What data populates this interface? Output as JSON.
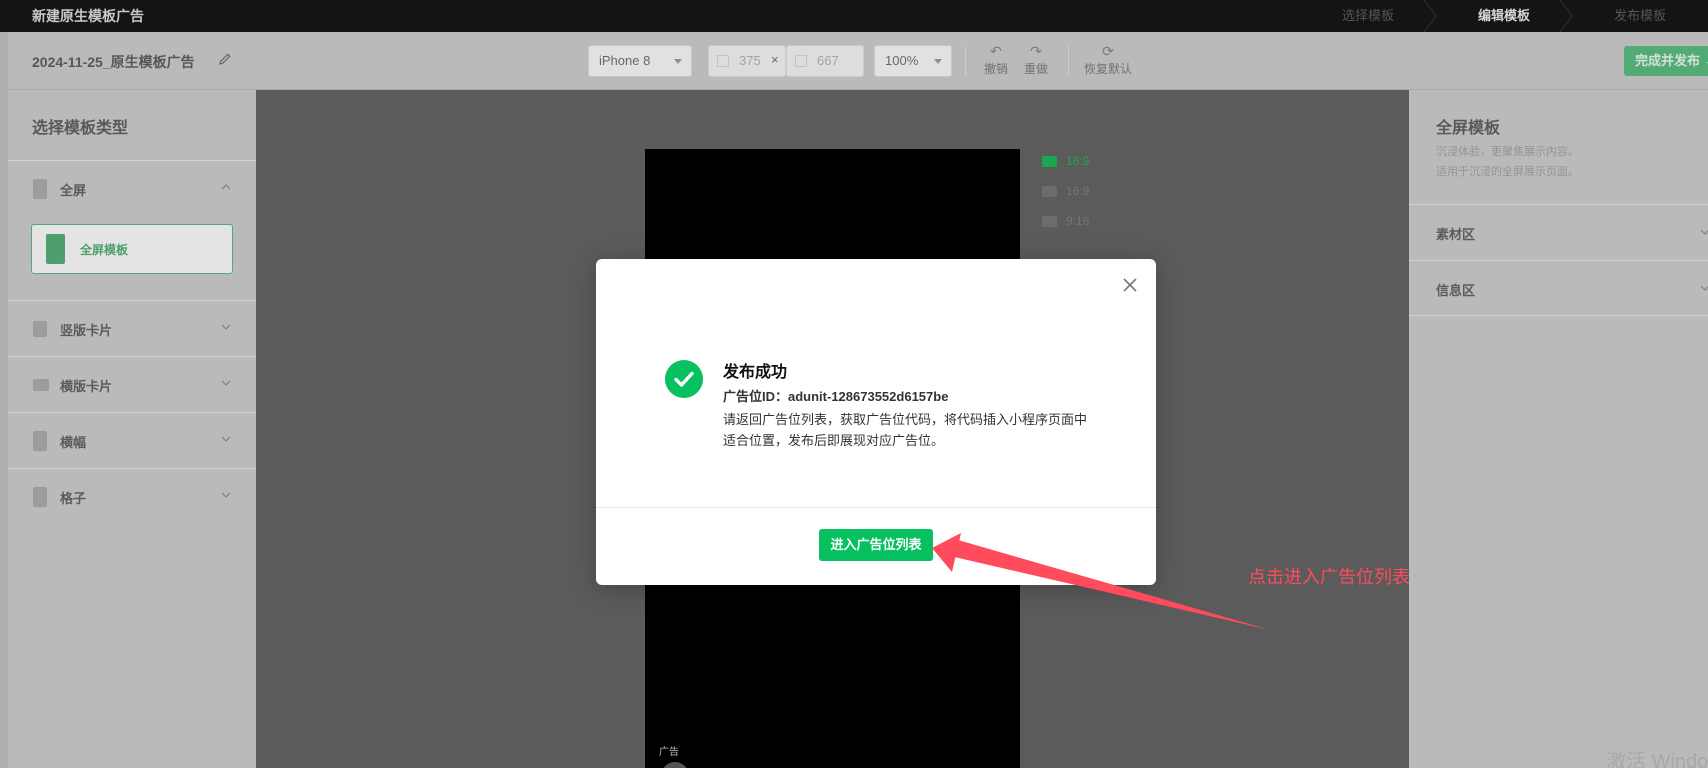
{
  "window": {
    "title": "新建原生模板广告"
  },
  "steps": [
    {
      "label": "选择模板",
      "active": false
    },
    {
      "label": "编辑模板",
      "active": true
    },
    {
      "label": "发布模板",
      "active": false
    }
  ],
  "toolbar": {
    "doc_title": "2024-11-25_原生模板广告",
    "device": "iPhone 8",
    "width": "375",
    "height": "667",
    "times": "×",
    "zoom": "100%",
    "undo_label": "撤销",
    "redo_label": "重做",
    "reset_label": "恢复默认",
    "publish_label": "完成并发布 →"
  },
  "left": {
    "title": "选择模板类型",
    "categories": [
      {
        "label": "全屏",
        "expanded": true
      },
      {
        "label": "竖版卡片"
      },
      {
        "label": "横版卡片"
      },
      {
        "label": "横幅"
      },
      {
        "label": "格子"
      }
    ],
    "template_card": "全屏模板"
  },
  "canvas": {
    "ad_mark": "广告",
    "ratios": [
      {
        "label": "16:9",
        "icon": "image-icon",
        "active": true
      },
      {
        "label": "16:9",
        "icon": "video-icon",
        "active": false
      },
      {
        "label": "9:16",
        "icon": "video-icon",
        "active": false
      }
    ]
  },
  "right": {
    "title": "全屏模板",
    "desc_line1": "沉浸体验，更聚焦展示内容。",
    "desc_line2": "适用于沉浸的全屏展示页面。",
    "sections": [
      "素材区",
      "信息区"
    ]
  },
  "modal": {
    "title": "发布成功",
    "ad_id": "广告位ID：adunit-128673552d6157be",
    "desc": "请返回广告位列表，获取广告位代码，将代码插入小程序页面中适合位置，发布后即展现对应广告位。",
    "button": "进入广告位列表"
  },
  "annotation": "点击进入广告位列表",
  "watermark": "激活 Windo",
  "colors": {
    "accent": "#07c160",
    "annotation": "#ff4b5c"
  }
}
